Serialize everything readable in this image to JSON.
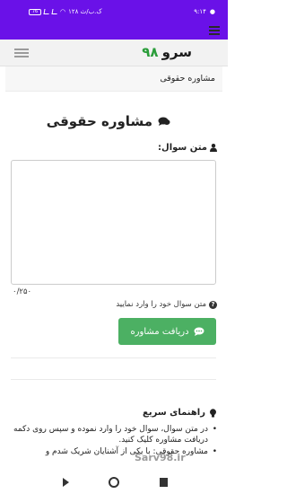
{
  "status_bar": {
    "time": "۹:۱۴",
    "battery": "76",
    "speed": "۱۲۸ ک.ب/ث"
  },
  "header": {
    "logo_word": "سرو",
    "logo_number": "۹۸"
  },
  "breadcrumb": "مشاوره حقوقی",
  "page_title": "مشاوره حقوقی",
  "form": {
    "question_label": "متن سوال:",
    "question_value": "",
    "counter": "۰/۲۵۰",
    "hint": "متن سوال خود را وارد نمایید",
    "submit_label": "دریافت مشاوره"
  },
  "guide": {
    "title": "راهنمای سریع",
    "items": [
      "در متن سوال، سوال خود را وارد نموده و سپس روی دکمه دریافت مشاوره کلیک کنید.",
      "مشاوره حقوقی: با یکی از آشنایان شریک شدم و"
    ]
  },
  "watermark": "Sarv98.ir",
  "colors": {
    "status_bar": "#6a11e8",
    "button": "#4cb063",
    "logo_number": "#2a9d3a"
  }
}
